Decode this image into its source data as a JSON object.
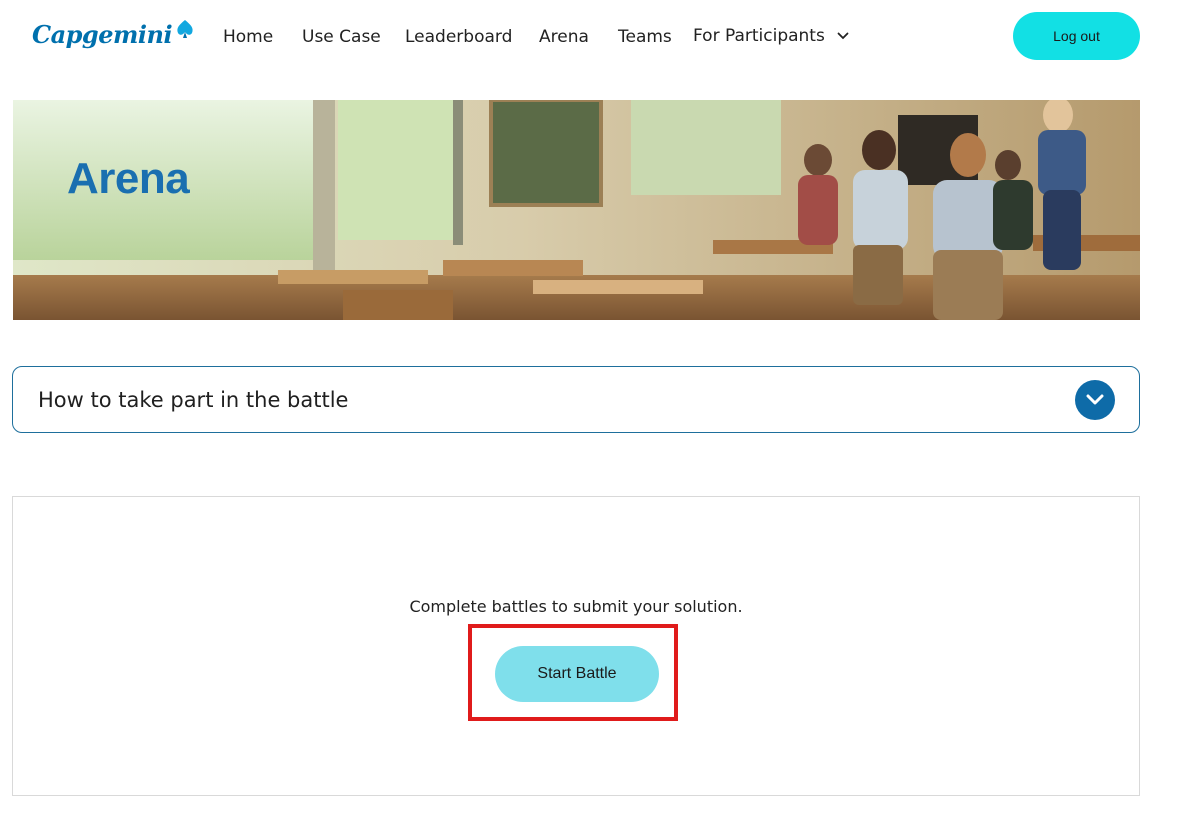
{
  "brand": {
    "logo_text": "Capgemini",
    "color": "#0070ad"
  },
  "nav": {
    "items": [
      {
        "label": "Home"
      },
      {
        "label": "Use Case"
      },
      {
        "label": "Leaderboard"
      },
      {
        "label": "Arena"
      },
      {
        "label": "Teams"
      },
      {
        "label": "For Participants",
        "icon": "chevron-down-icon"
      }
    ],
    "logout_label": "Log out"
  },
  "banner": {
    "title": "Arena"
  },
  "accordion": {
    "title": "How to take part in the battle",
    "toggle_icon": "chevron-down-icon"
  },
  "battle": {
    "message": "Complete battles to submit your solution.",
    "start_label": "Start Battle"
  },
  "colors": {
    "accent_cyan": "#12e0e4",
    "button_light_cyan": "#7fdfeb",
    "primary_blue": "#0e6ba8",
    "highlight_red": "#e01b1b"
  }
}
